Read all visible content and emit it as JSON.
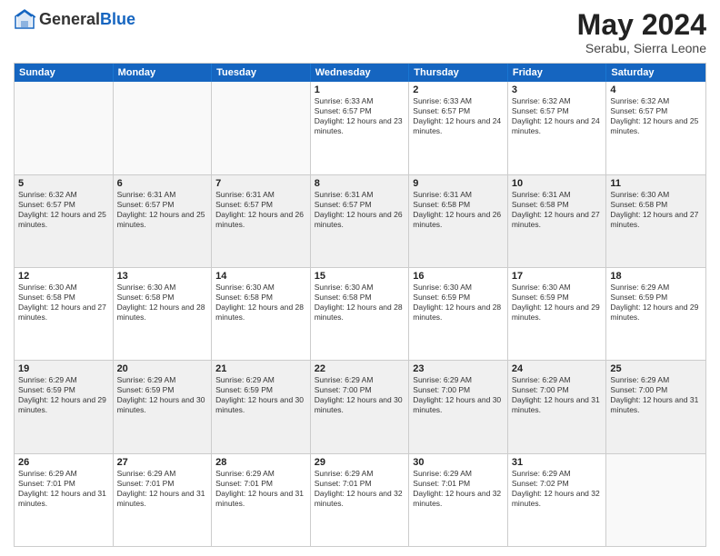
{
  "header": {
    "logo_general": "General",
    "logo_blue": "Blue",
    "month_title": "May 2024",
    "location": "Serabu, Sierra Leone"
  },
  "days_of_week": [
    "Sunday",
    "Monday",
    "Tuesday",
    "Wednesday",
    "Thursday",
    "Friday",
    "Saturday"
  ],
  "weeks": [
    [
      {
        "day": "",
        "empty": true
      },
      {
        "day": "",
        "empty": true
      },
      {
        "day": "",
        "empty": true
      },
      {
        "day": "1",
        "sunrise": "6:33 AM",
        "sunset": "6:57 PM",
        "daylight": "12 hours and 23 minutes."
      },
      {
        "day": "2",
        "sunrise": "6:33 AM",
        "sunset": "6:57 PM",
        "daylight": "12 hours and 24 minutes."
      },
      {
        "day": "3",
        "sunrise": "6:32 AM",
        "sunset": "6:57 PM",
        "daylight": "12 hours and 24 minutes."
      },
      {
        "day": "4",
        "sunrise": "6:32 AM",
        "sunset": "6:57 PM",
        "daylight": "12 hours and 25 minutes."
      }
    ],
    [
      {
        "day": "5",
        "sunrise": "6:32 AM",
        "sunset": "6:57 PM",
        "daylight": "12 hours and 25 minutes."
      },
      {
        "day": "6",
        "sunrise": "6:31 AM",
        "sunset": "6:57 PM",
        "daylight": "12 hours and 25 minutes."
      },
      {
        "day": "7",
        "sunrise": "6:31 AM",
        "sunset": "6:57 PM",
        "daylight": "12 hours and 26 minutes."
      },
      {
        "day": "8",
        "sunrise": "6:31 AM",
        "sunset": "6:57 PM",
        "daylight": "12 hours and 26 minutes."
      },
      {
        "day": "9",
        "sunrise": "6:31 AM",
        "sunset": "6:58 PM",
        "daylight": "12 hours and 26 minutes."
      },
      {
        "day": "10",
        "sunrise": "6:31 AM",
        "sunset": "6:58 PM",
        "daylight": "12 hours and 27 minutes."
      },
      {
        "day": "11",
        "sunrise": "6:30 AM",
        "sunset": "6:58 PM",
        "daylight": "12 hours and 27 minutes."
      }
    ],
    [
      {
        "day": "12",
        "sunrise": "6:30 AM",
        "sunset": "6:58 PM",
        "daylight": "12 hours and 27 minutes."
      },
      {
        "day": "13",
        "sunrise": "6:30 AM",
        "sunset": "6:58 PM",
        "daylight": "12 hours and 28 minutes."
      },
      {
        "day": "14",
        "sunrise": "6:30 AM",
        "sunset": "6:58 PM",
        "daylight": "12 hours and 28 minutes."
      },
      {
        "day": "15",
        "sunrise": "6:30 AM",
        "sunset": "6:58 PM",
        "daylight": "12 hours and 28 minutes."
      },
      {
        "day": "16",
        "sunrise": "6:30 AM",
        "sunset": "6:59 PM",
        "daylight": "12 hours and 28 minutes."
      },
      {
        "day": "17",
        "sunrise": "6:30 AM",
        "sunset": "6:59 PM",
        "daylight": "12 hours and 29 minutes."
      },
      {
        "day": "18",
        "sunrise": "6:29 AM",
        "sunset": "6:59 PM",
        "daylight": "12 hours and 29 minutes."
      }
    ],
    [
      {
        "day": "19",
        "sunrise": "6:29 AM",
        "sunset": "6:59 PM",
        "daylight": "12 hours and 29 minutes."
      },
      {
        "day": "20",
        "sunrise": "6:29 AM",
        "sunset": "6:59 PM",
        "daylight": "12 hours and 30 minutes."
      },
      {
        "day": "21",
        "sunrise": "6:29 AM",
        "sunset": "6:59 PM",
        "daylight": "12 hours and 30 minutes."
      },
      {
        "day": "22",
        "sunrise": "6:29 AM",
        "sunset": "7:00 PM",
        "daylight": "12 hours and 30 minutes."
      },
      {
        "day": "23",
        "sunrise": "6:29 AM",
        "sunset": "7:00 PM",
        "daylight": "12 hours and 30 minutes."
      },
      {
        "day": "24",
        "sunrise": "6:29 AM",
        "sunset": "7:00 PM",
        "daylight": "12 hours and 31 minutes."
      },
      {
        "day": "25",
        "sunrise": "6:29 AM",
        "sunset": "7:00 PM",
        "daylight": "12 hours and 31 minutes."
      }
    ],
    [
      {
        "day": "26",
        "sunrise": "6:29 AM",
        "sunset": "7:01 PM",
        "daylight": "12 hours and 31 minutes."
      },
      {
        "day": "27",
        "sunrise": "6:29 AM",
        "sunset": "7:01 PM",
        "daylight": "12 hours and 31 minutes."
      },
      {
        "day": "28",
        "sunrise": "6:29 AM",
        "sunset": "7:01 PM",
        "daylight": "12 hours and 31 minutes."
      },
      {
        "day": "29",
        "sunrise": "6:29 AM",
        "sunset": "7:01 PM",
        "daylight": "12 hours and 32 minutes."
      },
      {
        "day": "30",
        "sunrise": "6:29 AM",
        "sunset": "7:01 PM",
        "daylight": "12 hours and 32 minutes."
      },
      {
        "day": "31",
        "sunrise": "6:29 AM",
        "sunset": "7:02 PM",
        "daylight": "12 hours and 32 minutes."
      },
      {
        "day": "",
        "empty": true
      }
    ]
  ]
}
